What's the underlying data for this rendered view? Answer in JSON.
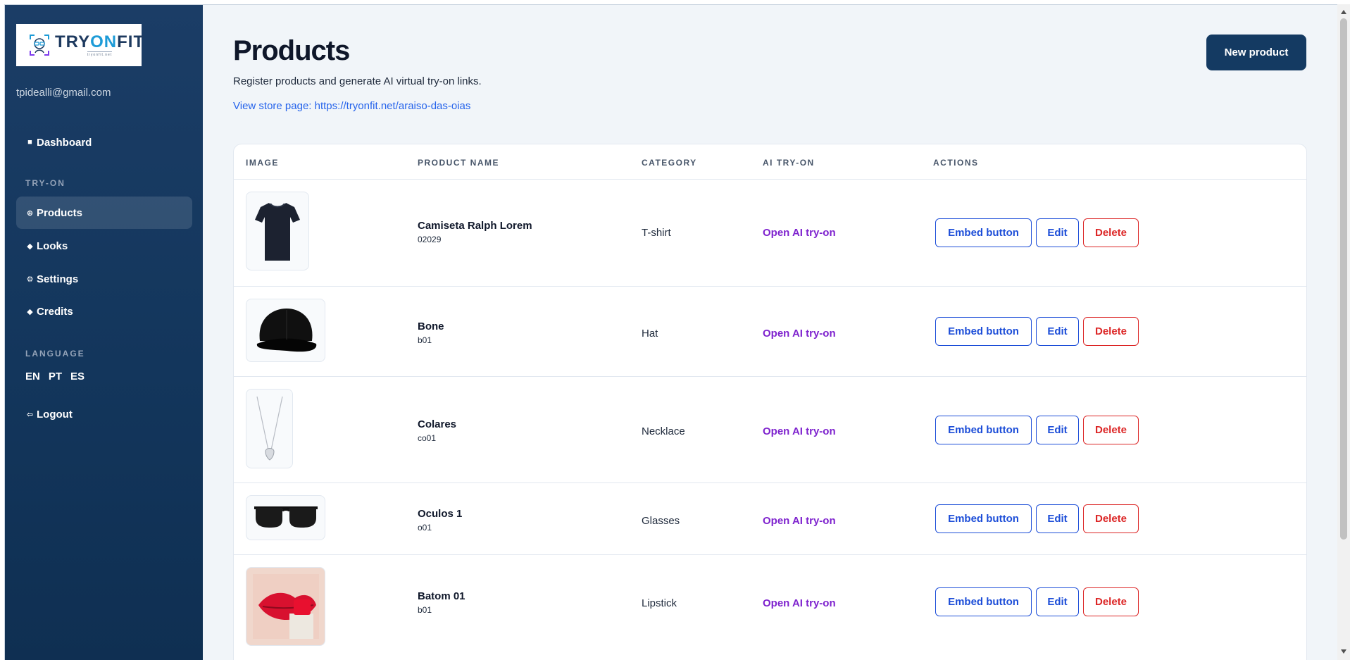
{
  "sidebar": {
    "logo": {
      "brand_pre": "TRY",
      "brand_on": "ON",
      "brand_post": "FIT",
      "sub": "tryonfit.net"
    },
    "email": "tpidealli@gmail.com",
    "dashboard": {
      "icon": "grid-icon",
      "label": "Dashboard"
    },
    "section_tryon": "TRY-ON",
    "items": [
      {
        "icon": "circle-plus-icon",
        "label": "Products"
      },
      {
        "icon": "diamond-icon",
        "label": "Looks"
      },
      {
        "icon": "gear-icon",
        "label": "Settings"
      },
      {
        "icon": "diamond-icon",
        "label": "Credits"
      }
    ],
    "section_language": "LANGUAGE",
    "languages": [
      "EN",
      "PT",
      "ES"
    ],
    "logout": {
      "icon": "logout-arrow-icon",
      "label": "Logout"
    }
  },
  "header": {
    "title": "Products",
    "subtitle": "Register products and generate AI virtual try-on links.",
    "store_link": "View store page: https://tryonfit.net/araiso-das-oias",
    "new_button": "New product"
  },
  "table": {
    "columns": [
      "IMAGE",
      "PRODUCT NAME",
      "CATEGORY",
      "AI TRY-ON",
      "ACTIONS"
    ],
    "rows": [
      {
        "image": "navy-tshirt",
        "name": "Camiseta Ralph Lorem",
        "code": "02029",
        "category": "T-shirt",
        "tryon": "Open AI try-on",
        "embed": "Embed button",
        "edit": "Edit",
        "delete": "Delete"
      },
      {
        "image": "black-cap",
        "name": "Bone",
        "code": "b01",
        "category": "Hat",
        "tryon": "Open AI try-on",
        "embed": "Embed button",
        "edit": "Edit",
        "delete": "Delete"
      },
      {
        "image": "silver-necklace",
        "name": "Colares",
        "code": "co01",
        "category": "Necklace",
        "tryon": "Open AI try-on",
        "embed": "Embed button",
        "edit": "Edit",
        "delete": "Delete"
      },
      {
        "image": "sunglasses",
        "name": "Oculos 1",
        "code": "o01",
        "category": "Glasses",
        "tryon": "Open AI try-on",
        "embed": "Embed button",
        "edit": "Edit",
        "delete": "Delete"
      },
      {
        "image": "red-lipstick-lips",
        "name": "Batom 01",
        "code": "b01",
        "category": "Lipstick",
        "tryon": "Open AI try-on",
        "embed": "Embed button",
        "edit": "Edit",
        "delete": "Delete"
      }
    ]
  },
  "colors": {
    "sidebar_bg": "#15395f",
    "primary_button": "#143a62",
    "link_blue": "#2563eb",
    "tryon_purple": "#7e22ce",
    "delete_red": "#dc2626"
  }
}
